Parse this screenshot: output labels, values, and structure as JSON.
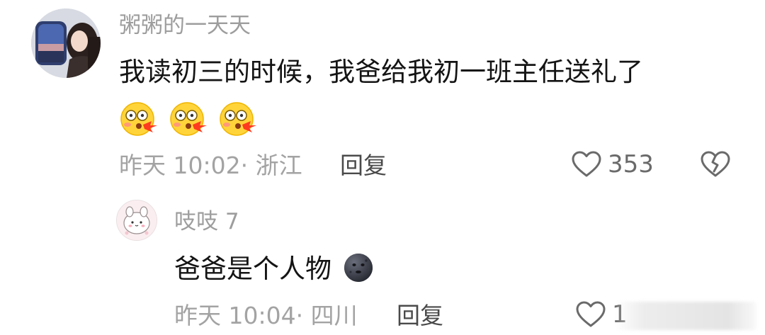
{
  "comment": {
    "username": "粥粥的一天天",
    "text": "我读初三的时候，我爸给我初一班主任送礼了",
    "emojis": [
      "blush-puff-emoji",
      "blush-puff-emoji",
      "blush-puff-emoji"
    ],
    "meta": "昨天 10:02· 浙江",
    "reply_label": "回复",
    "like_count": "353"
  },
  "reply": {
    "username": "吱吱 7",
    "text": "爸爸是个人物",
    "emoji": "new-moon-face-emoji",
    "meta": "昨天 10:04· 四川",
    "reply_label": "回复",
    "like_count": "1"
  },
  "colors": {
    "username": "#9d9d9d",
    "meta": "#a3a3a3",
    "text": "#141414",
    "icon": "#6a6a6a"
  }
}
